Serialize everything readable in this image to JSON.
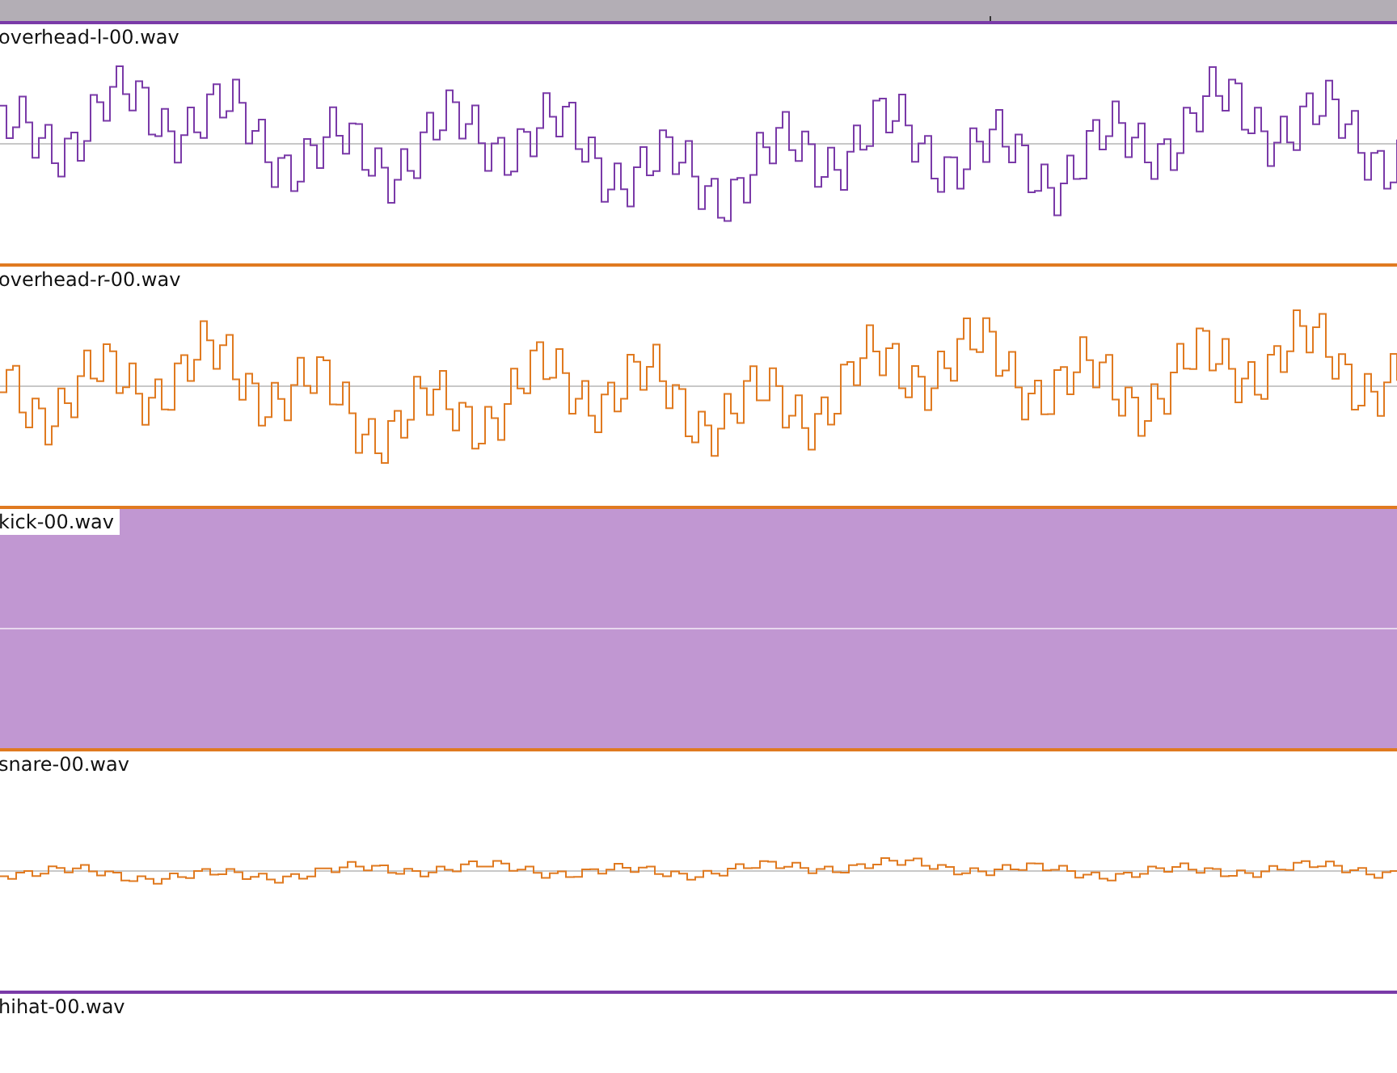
{
  "regions": [
    {
      "name": "overhead-l-00.wav",
      "color": "#7a3aa8",
      "selected": false,
      "kind": "loud"
    },
    {
      "name": "overhead-r-00.wav",
      "color": "#e07a20",
      "selected": false,
      "kind": "loud"
    },
    {
      "name": "kick-00.wav",
      "color": "#e07a20",
      "selected": true,
      "kind": "silent"
    },
    {
      "name": "snare-00.wav",
      "color": "#e07a20",
      "selected": false,
      "kind": "quiet"
    },
    {
      "name": "hihat-00.wav",
      "color": "#7a3aa8",
      "selected": false,
      "kind": "silent"
    }
  ]
}
